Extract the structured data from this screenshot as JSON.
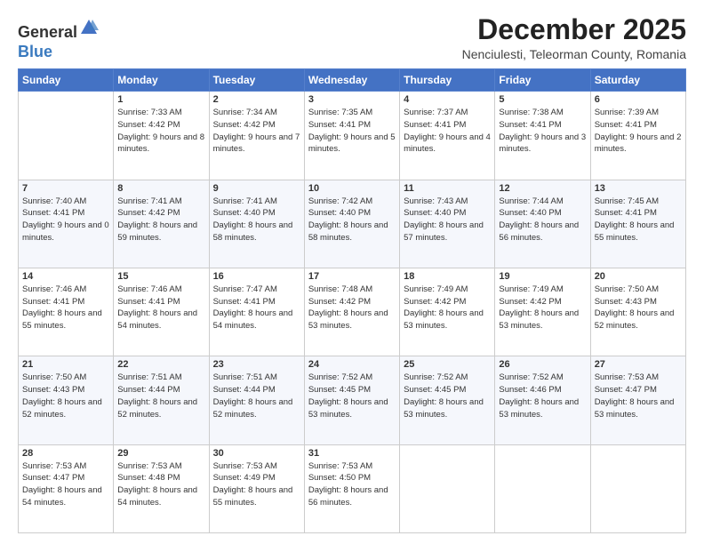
{
  "logo": {
    "general": "General",
    "blue": "Blue"
  },
  "title": "December 2025",
  "location": "Nenciulesti, Teleorman County, Romania",
  "days_of_week": [
    "Sunday",
    "Monday",
    "Tuesday",
    "Wednesday",
    "Thursday",
    "Friday",
    "Saturday"
  ],
  "weeks": [
    [
      {
        "day": "",
        "sunrise": "",
        "sunset": "",
        "daylight": ""
      },
      {
        "day": "1",
        "sunrise": "Sunrise: 7:33 AM",
        "sunset": "Sunset: 4:42 PM",
        "daylight": "Daylight: 9 hours and 8 minutes."
      },
      {
        "day": "2",
        "sunrise": "Sunrise: 7:34 AM",
        "sunset": "Sunset: 4:42 PM",
        "daylight": "Daylight: 9 hours and 7 minutes."
      },
      {
        "day": "3",
        "sunrise": "Sunrise: 7:35 AM",
        "sunset": "Sunset: 4:41 PM",
        "daylight": "Daylight: 9 hours and 5 minutes."
      },
      {
        "day": "4",
        "sunrise": "Sunrise: 7:37 AM",
        "sunset": "Sunset: 4:41 PM",
        "daylight": "Daylight: 9 hours and 4 minutes."
      },
      {
        "day": "5",
        "sunrise": "Sunrise: 7:38 AM",
        "sunset": "Sunset: 4:41 PM",
        "daylight": "Daylight: 9 hours and 3 minutes."
      },
      {
        "day": "6",
        "sunrise": "Sunrise: 7:39 AM",
        "sunset": "Sunset: 4:41 PM",
        "daylight": "Daylight: 9 hours and 2 minutes."
      }
    ],
    [
      {
        "day": "7",
        "sunrise": "Sunrise: 7:40 AM",
        "sunset": "Sunset: 4:41 PM",
        "daylight": "Daylight: 9 hours and 0 minutes."
      },
      {
        "day": "8",
        "sunrise": "Sunrise: 7:41 AM",
        "sunset": "Sunset: 4:42 PM",
        "daylight": "Daylight: 8 hours and 59 minutes."
      },
      {
        "day": "9",
        "sunrise": "Sunrise: 7:41 AM",
        "sunset": "Sunset: 4:40 PM",
        "daylight": "Daylight: 8 hours and 58 minutes."
      },
      {
        "day": "10",
        "sunrise": "Sunrise: 7:42 AM",
        "sunset": "Sunset: 4:40 PM",
        "daylight": "Daylight: 8 hours and 58 minutes."
      },
      {
        "day": "11",
        "sunrise": "Sunrise: 7:43 AM",
        "sunset": "Sunset: 4:40 PM",
        "daylight": "Daylight: 8 hours and 57 minutes."
      },
      {
        "day": "12",
        "sunrise": "Sunrise: 7:44 AM",
        "sunset": "Sunset: 4:40 PM",
        "daylight": "Daylight: 8 hours and 56 minutes."
      },
      {
        "day": "13",
        "sunrise": "Sunrise: 7:45 AM",
        "sunset": "Sunset: 4:41 PM",
        "daylight": "Daylight: 8 hours and 55 minutes."
      }
    ],
    [
      {
        "day": "14",
        "sunrise": "Sunrise: 7:46 AM",
        "sunset": "Sunset: 4:41 PM",
        "daylight": "Daylight: 8 hours and 55 minutes."
      },
      {
        "day": "15",
        "sunrise": "Sunrise: 7:46 AM",
        "sunset": "Sunset: 4:41 PM",
        "daylight": "Daylight: 8 hours and 54 minutes."
      },
      {
        "day": "16",
        "sunrise": "Sunrise: 7:47 AM",
        "sunset": "Sunset: 4:41 PM",
        "daylight": "Daylight: 8 hours and 54 minutes."
      },
      {
        "day": "17",
        "sunrise": "Sunrise: 7:48 AM",
        "sunset": "Sunset: 4:42 PM",
        "daylight": "Daylight: 8 hours and 53 minutes."
      },
      {
        "day": "18",
        "sunrise": "Sunrise: 7:49 AM",
        "sunset": "Sunset: 4:42 PM",
        "daylight": "Daylight: 8 hours and 53 minutes."
      },
      {
        "day": "19",
        "sunrise": "Sunrise: 7:49 AM",
        "sunset": "Sunset: 4:42 PM",
        "daylight": "Daylight: 8 hours and 53 minutes."
      },
      {
        "day": "20",
        "sunrise": "Sunrise: 7:50 AM",
        "sunset": "Sunset: 4:43 PM",
        "daylight": "Daylight: 8 hours and 52 minutes."
      }
    ],
    [
      {
        "day": "21",
        "sunrise": "Sunrise: 7:50 AM",
        "sunset": "Sunset: 4:43 PM",
        "daylight": "Daylight: 8 hours and 52 minutes."
      },
      {
        "day": "22",
        "sunrise": "Sunrise: 7:51 AM",
        "sunset": "Sunset: 4:44 PM",
        "daylight": "Daylight: 8 hours and 52 minutes."
      },
      {
        "day": "23",
        "sunrise": "Sunrise: 7:51 AM",
        "sunset": "Sunset: 4:44 PM",
        "daylight": "Daylight: 8 hours and 52 minutes."
      },
      {
        "day": "24",
        "sunrise": "Sunrise: 7:52 AM",
        "sunset": "Sunset: 4:45 PM",
        "daylight": "Daylight: 8 hours and 53 minutes."
      },
      {
        "day": "25",
        "sunrise": "Sunrise: 7:52 AM",
        "sunset": "Sunset: 4:45 PM",
        "daylight": "Daylight: 8 hours and 53 minutes."
      },
      {
        "day": "26",
        "sunrise": "Sunrise: 7:52 AM",
        "sunset": "Sunset: 4:46 PM",
        "daylight": "Daylight: 8 hours and 53 minutes."
      },
      {
        "day": "27",
        "sunrise": "Sunrise: 7:53 AM",
        "sunset": "Sunset: 4:47 PM",
        "daylight": "Daylight: 8 hours and 53 minutes."
      }
    ],
    [
      {
        "day": "28",
        "sunrise": "Sunrise: 7:53 AM",
        "sunset": "Sunset: 4:47 PM",
        "daylight": "Daylight: 8 hours and 54 minutes."
      },
      {
        "day": "29",
        "sunrise": "Sunrise: 7:53 AM",
        "sunset": "Sunset: 4:48 PM",
        "daylight": "Daylight: 8 hours and 54 minutes."
      },
      {
        "day": "30",
        "sunrise": "Sunrise: 7:53 AM",
        "sunset": "Sunset: 4:49 PM",
        "daylight": "Daylight: 8 hours and 55 minutes."
      },
      {
        "day": "31",
        "sunrise": "Sunrise: 7:53 AM",
        "sunset": "Sunset: 4:50 PM",
        "daylight": "Daylight: 8 hours and 56 minutes."
      },
      {
        "day": "",
        "sunrise": "",
        "sunset": "",
        "daylight": ""
      },
      {
        "day": "",
        "sunrise": "",
        "sunset": "",
        "daylight": ""
      },
      {
        "day": "",
        "sunrise": "",
        "sunset": "",
        "daylight": ""
      }
    ]
  ]
}
